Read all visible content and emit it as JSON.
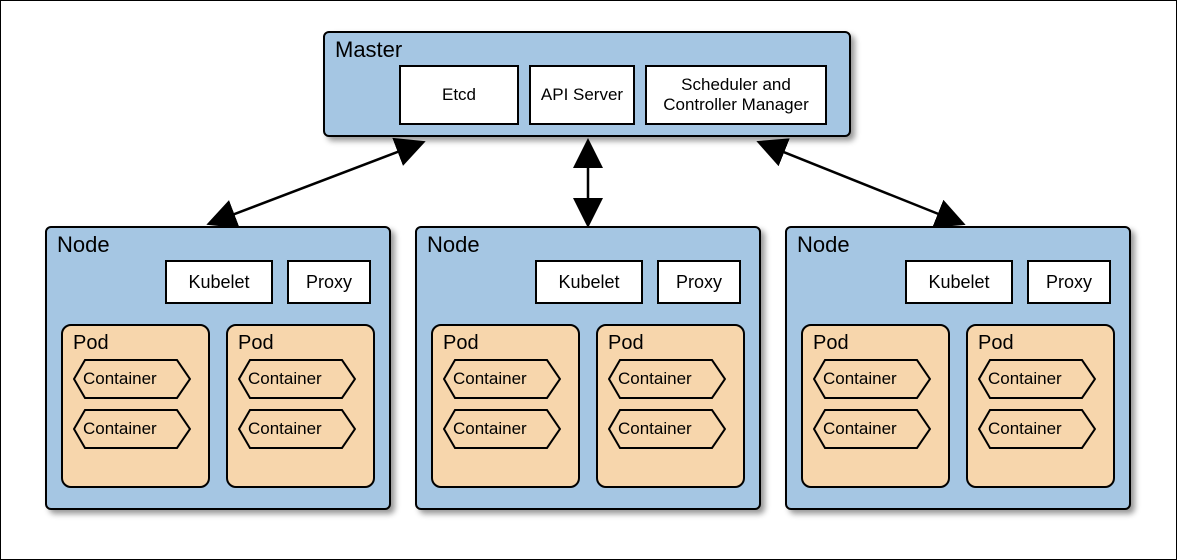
{
  "master": {
    "title": "Master",
    "components": {
      "etcd": "Etcd",
      "api": "API Server",
      "sched": "Scheduler and Controller Manager"
    }
  },
  "nodes": [
    {
      "title": "Node",
      "kubelet": "Kubelet",
      "proxy": "Proxy",
      "pods": [
        {
          "title": "Pod",
          "containers": [
            "Container",
            "Container"
          ]
        },
        {
          "title": "Pod",
          "containers": [
            "Container",
            "Container"
          ]
        }
      ]
    },
    {
      "title": "Node",
      "kubelet": "Kubelet",
      "proxy": "Proxy",
      "pods": [
        {
          "title": "Pod",
          "containers": [
            "Container",
            "Container"
          ]
        },
        {
          "title": "Pod",
          "containers": [
            "Container",
            "Container"
          ]
        }
      ]
    },
    {
      "title": "Node",
      "kubelet": "Kubelet",
      "proxy": "Proxy",
      "pods": [
        {
          "title": "Pod",
          "containers": [
            "Container",
            "Container"
          ]
        },
        {
          "title": "Pod",
          "containers": [
            "Container",
            "Container"
          ]
        }
      ]
    }
  ],
  "colors": {
    "node_bg": "#a5c6e3",
    "pod_bg": "#f7d6ac",
    "border": "#000000"
  }
}
